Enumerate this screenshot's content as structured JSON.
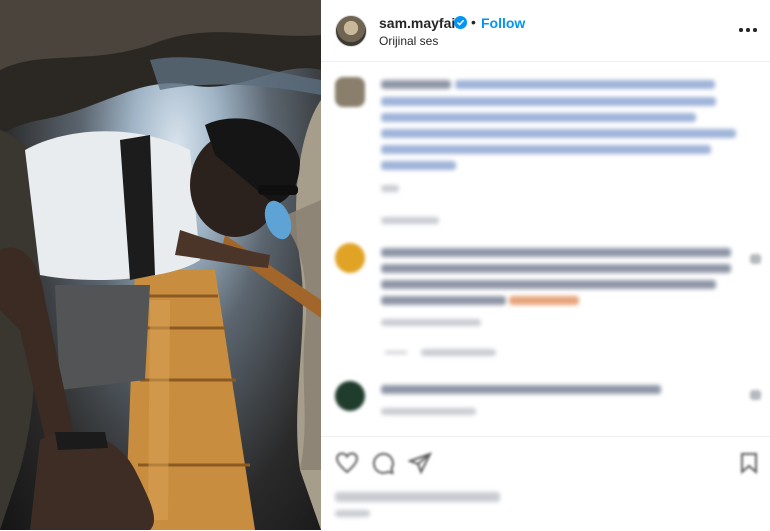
{
  "post": {
    "username": "sam.mayfair",
    "separator": "•",
    "follow_label": "Follow",
    "audio_label": "Orijinal ses"
  },
  "icons": {
    "verified": "verified-badge-icon",
    "more": "more-options-icon",
    "like": "heart-icon",
    "comment": "comment-icon",
    "share": "send-icon",
    "save": "bookmark-icon"
  },
  "colors": {
    "accent": "#0095f6",
    "text": "#262626",
    "divider": "#efefef"
  }
}
